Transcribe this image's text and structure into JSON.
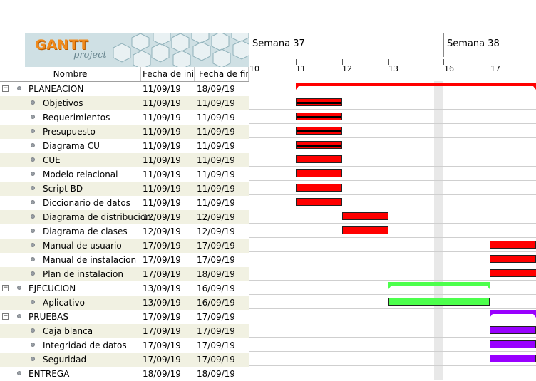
{
  "logo": {
    "word": "GANTT",
    "sub": "project"
  },
  "columns": {
    "name": "Nombre",
    "start": "Fecha de ini...",
    "end": "Fecha de fin"
  },
  "timeline": {
    "weeks": [
      "Semana 37",
      "Semana 38"
    ],
    "days": [
      "10",
      "11",
      "12",
      "13",
      "16",
      "17"
    ]
  },
  "colors": {
    "red": "#ff0000",
    "green": "#4cff4c",
    "purple": "#9900ff",
    "grid": "#cfcfcf"
  },
  "tasks": [
    {
      "name": "PLANEACION",
      "start": "11/09/19",
      "end": "18/09/19",
      "level": 0,
      "expander": "−"
    },
    {
      "name": "Objetivos",
      "start": "11/09/19",
      "end": "11/09/19",
      "level": 1
    },
    {
      "name": "Requerimientos",
      "start": "11/09/19",
      "end": "11/09/19",
      "level": 1
    },
    {
      "name": "Presupuesto",
      "start": "11/09/19",
      "end": "11/09/19",
      "level": 1
    },
    {
      "name": "Diagrama CU",
      "start": "11/09/19",
      "end": "11/09/19",
      "level": 1
    },
    {
      "name": "CUE",
      "start": "11/09/19",
      "end": "11/09/19",
      "level": 1
    },
    {
      "name": "Modelo relacional",
      "start": "11/09/19",
      "end": "11/09/19",
      "level": 1
    },
    {
      "name": "Script BD",
      "start": "11/09/19",
      "end": "11/09/19",
      "level": 1
    },
    {
      "name": "Diccionario de datos",
      "start": "11/09/19",
      "end": "11/09/19",
      "level": 1
    },
    {
      "name": "Diagrama de distribucion",
      "start": "12/09/19",
      "end": "12/09/19",
      "level": 1
    },
    {
      "name": "Diagrama de clases",
      "start": "12/09/19",
      "end": "12/09/19",
      "level": 1
    },
    {
      "name": "Manual de usuario",
      "start": "17/09/19",
      "end": "17/09/19",
      "level": 1
    },
    {
      "name": "Manual de instalacion",
      "start": "17/09/19",
      "end": "17/09/19",
      "level": 1
    },
    {
      "name": "Plan de instalacion",
      "start": "17/09/19",
      "end": "18/09/19",
      "level": 1
    },
    {
      "name": "EJECUCION",
      "start": "13/09/19",
      "end": "16/09/19",
      "level": 0,
      "expander": "−"
    },
    {
      "name": "Aplicativo",
      "start": "13/09/19",
      "end": "16/09/19",
      "level": 1
    },
    {
      "name": "PRUEBAS",
      "start": "17/09/19",
      "end": "17/09/19",
      "level": 0,
      "expander": "−"
    },
    {
      "name": "Caja blanca",
      "start": "17/09/19",
      "end": "17/09/19",
      "level": 1
    },
    {
      "name": "Integridad de datos",
      "start": "17/09/19",
      "end": "17/09/19",
      "level": 1
    },
    {
      "name": "Seguridad",
      "start": "17/09/19",
      "end": "17/09/19",
      "level": 1
    },
    {
      "name": "ENTREGA",
      "start": "18/09/19",
      "end": "18/09/19",
      "level": 0
    }
  ],
  "bars": [
    {
      "row": 0,
      "kind": "summary",
      "color": "red",
      "from": "11",
      "to": "18"
    },
    {
      "row": 1,
      "kind": "task",
      "color": "red",
      "from": "11",
      "to": "12",
      "progress": 1
    },
    {
      "row": 2,
      "kind": "task",
      "color": "red",
      "from": "11",
      "to": "12",
      "progress": 1
    },
    {
      "row": 3,
      "kind": "task",
      "color": "red",
      "from": "11",
      "to": "12",
      "progress": 1
    },
    {
      "row": 4,
      "kind": "task",
      "color": "red",
      "from": "11",
      "to": "12",
      "progress": 1
    },
    {
      "row": 5,
      "kind": "task",
      "color": "red",
      "from": "11",
      "to": "12",
      "progress": 0
    },
    {
      "row": 6,
      "kind": "task",
      "color": "red",
      "from": "11",
      "to": "12",
      "progress": 0
    },
    {
      "row": 7,
      "kind": "task",
      "color": "red",
      "from": "11",
      "to": "12",
      "progress": 0
    },
    {
      "row": 8,
      "kind": "task",
      "color": "red",
      "from": "11",
      "to": "12",
      "progress": 0
    },
    {
      "row": 9,
      "kind": "task",
      "color": "red",
      "from": "12",
      "to": "13",
      "progress": 0
    },
    {
      "row": 10,
      "kind": "task",
      "color": "red",
      "from": "12",
      "to": "13",
      "progress": 0
    },
    {
      "row": 11,
      "kind": "task",
      "color": "red",
      "from": "17",
      "to": "18",
      "progress": 0
    },
    {
      "row": 12,
      "kind": "task",
      "color": "red",
      "from": "17",
      "to": "18",
      "progress": 0
    },
    {
      "row": 13,
      "kind": "task",
      "color": "red",
      "from": "17",
      "to": "19",
      "progress": 0
    },
    {
      "row": 14,
      "kind": "summary",
      "color": "green",
      "from": "13",
      "to": "17"
    },
    {
      "row": 15,
      "kind": "task",
      "color": "green",
      "from": "13",
      "to": "17",
      "progress": 0
    },
    {
      "row": 16,
      "kind": "summary",
      "color": "purple",
      "from": "17",
      "to": "18"
    },
    {
      "row": 17,
      "kind": "task",
      "color": "purple",
      "from": "17",
      "to": "18",
      "progress": 0
    },
    {
      "row": 18,
      "kind": "task",
      "color": "purple",
      "from": "17",
      "to": "18",
      "progress": 0
    },
    {
      "row": 19,
      "kind": "task",
      "color": "purple",
      "from": "17",
      "to": "18",
      "progress": 0
    }
  ]
}
